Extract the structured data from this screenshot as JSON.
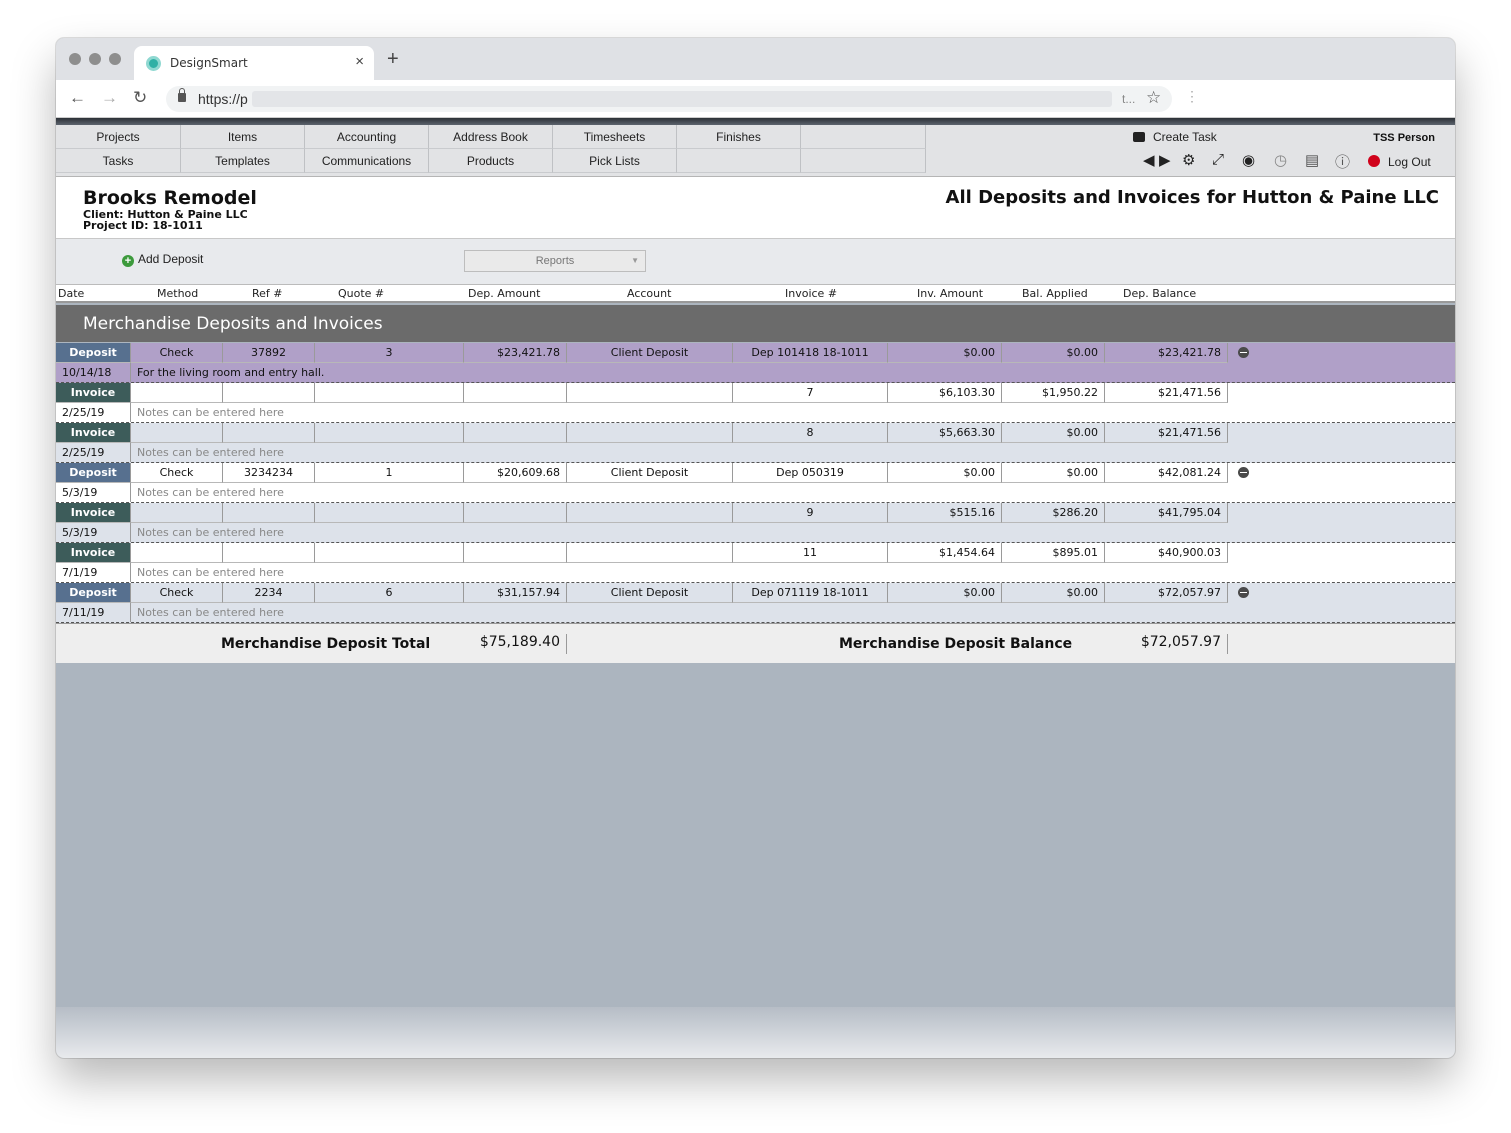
{
  "browser": {
    "tab_title": "DesignSmart",
    "tab_close": "×",
    "new_tab": "+",
    "url_prefix": "https://p",
    "url_ellipsis": "t...",
    "back": "←",
    "forward": "→",
    "reload": "↻",
    "star": "☆",
    "menu": "⋮"
  },
  "nav": {
    "row1": [
      "Projects",
      "Items",
      "Accounting",
      "Address Book",
      "Timesheets",
      "Finishes",
      ""
    ],
    "row2": [
      "Tasks",
      "Templates",
      "Communications",
      "Products",
      "Pick Lists",
      "",
      ""
    ],
    "create_task": "Create Task",
    "user": "TSS Person",
    "logout": "Log Out",
    "tool_icons": [
      "prev-next-arrows",
      "gear",
      "expand",
      "person",
      "clock",
      "window",
      "info"
    ]
  },
  "header": {
    "project_name": "Brooks Remodel",
    "client": "Client: Hutton & Paine LLC",
    "project_id": "Project ID: 18-1011",
    "page_title": "All Deposits and Invoices for Hutton & Paine LLC"
  },
  "toolbar": {
    "add_deposit": "Add Deposit",
    "reports": "Reports"
  },
  "columns": [
    "Date",
    "Method",
    "Ref #",
    "Quote #",
    "Dep. Amount",
    "Account",
    "Invoice #",
    "Inv. Amount",
    "Bal. Applied",
    "Dep. Balance"
  ],
  "section_title": "Merchandise Deposits and Invoices",
  "records": [
    {
      "type": "Deposit",
      "method": "Check",
      "ref": "37892",
      "quote": "3",
      "dep_amount": "$23,421.78",
      "account": "Client Deposit",
      "invoice": "Dep 101418 18-1011",
      "inv_amount": "$0.00",
      "bal_applied": "$0.00",
      "dep_balance": "$23,421.78",
      "date": "10/14/18",
      "note": "For the living room and entry hall."
    },
    {
      "type": "Invoice",
      "method": "",
      "ref": "",
      "quote": "",
      "dep_amount": "",
      "account": "",
      "invoice": "7",
      "inv_amount": "$6,103.30",
      "bal_applied": "$1,950.22",
      "dep_balance": "$21,471.56",
      "date": "2/25/19",
      "note": "Notes can be entered here"
    },
    {
      "type": "Invoice",
      "method": "",
      "ref": "",
      "quote": "",
      "dep_amount": "",
      "account": "",
      "invoice": "8",
      "inv_amount": "$5,663.30",
      "bal_applied": "$0.00",
      "dep_balance": "$21,471.56",
      "date": "2/25/19",
      "note": "Notes can be entered here"
    },
    {
      "type": "Deposit",
      "method": "Check",
      "ref": "3234234",
      "quote": "1",
      "dep_amount": "$20,609.68",
      "account": "Client Deposit",
      "invoice": "Dep 050319",
      "inv_amount": "$0.00",
      "bal_applied": "$0.00",
      "dep_balance": "$42,081.24",
      "date": "5/3/19",
      "note": "Notes can be entered here"
    },
    {
      "type": "Invoice",
      "method": "",
      "ref": "",
      "quote": "",
      "dep_amount": "",
      "account": "",
      "invoice": "9",
      "inv_amount": "$515.16",
      "bal_applied": "$286.20",
      "dep_balance": "$41,795.04",
      "date": "5/3/19",
      "note": "Notes can be entered here"
    },
    {
      "type": "Invoice",
      "method": "",
      "ref": "",
      "quote": "",
      "dep_amount": "",
      "account": "",
      "invoice": "11",
      "inv_amount": "$1,454.64",
      "bal_applied": "$895.01",
      "dep_balance": "$40,900.03",
      "date": "7/1/19",
      "note": "Notes can be entered here"
    },
    {
      "type": "Deposit",
      "method": "Check",
      "ref": "2234",
      "quote": "6",
      "dep_amount": "$31,157.94",
      "account": "Client Deposit",
      "invoice": "Dep 071119 18-1011",
      "inv_amount": "$0.00",
      "bal_applied": "$0.00",
      "dep_balance": "$72,057.97",
      "date": "7/11/19",
      "note": "Notes can be entered here"
    }
  ],
  "totals": {
    "deposit_total_label": "Merchandise Deposit Total",
    "deposit_total_value": "$75,189.40",
    "deposit_balance_label": "Merchandise Deposit Balance",
    "deposit_balance_value": "$72,057.97"
  },
  "colors": {
    "deposit_badge": "#57708f",
    "invoice_badge": "#3d5c5a",
    "selected_row": "#b0a0c8",
    "section_bar": "#6b6b6b",
    "logout_icon": "#d0021b",
    "add_icon": "#3c9a3c"
  }
}
